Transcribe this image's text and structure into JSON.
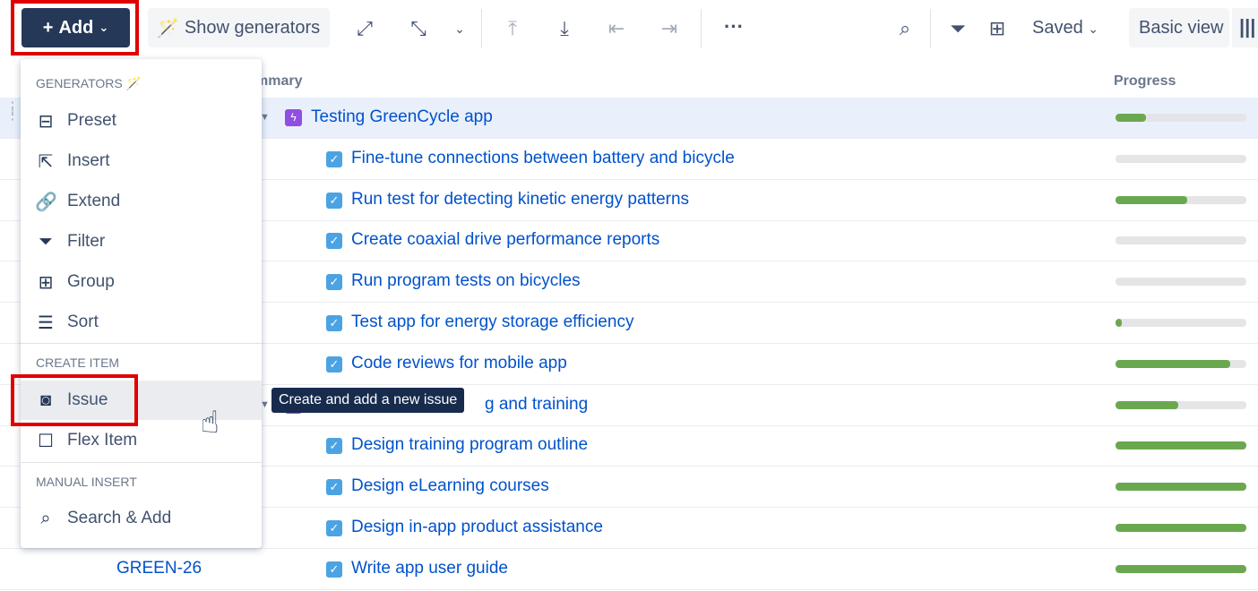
{
  "toolbar": {
    "add_label": "Add",
    "show_generators_label": "Show generators",
    "saved_label": "Saved",
    "basic_view_label": "Basic view",
    "more_label": "···"
  },
  "columns": {
    "summary": "mmary",
    "progress": "Progress"
  },
  "rows": [
    {
      "id": "",
      "title": "Testing GreenCycle app",
      "type": "epic",
      "progress": 23,
      "selected": true
    },
    {
      "id": "",
      "title": "Fine-tune connections between battery and bicycle",
      "type": "task",
      "progress": 0
    },
    {
      "id": "",
      "title": "Run test for detecting kinetic energy patterns",
      "type": "task",
      "progress": 55
    },
    {
      "id": "",
      "title": "Create coaxial drive performance reports",
      "type": "task",
      "progress": 0
    },
    {
      "id": "",
      "title": "Run program tests on bicycles",
      "type": "task",
      "progress": 0
    },
    {
      "id": "",
      "title": "Test app for energy storage efficiency",
      "type": "task",
      "progress": 5
    },
    {
      "id": "",
      "title": "Code reviews for mobile app",
      "type": "task",
      "progress": 88
    },
    {
      "id": "",
      "title": "g and training",
      "type": "epic",
      "progress": 48
    },
    {
      "id": "",
      "title": "Design training program outline",
      "type": "task",
      "progress": 100
    },
    {
      "id": "",
      "title": "Design eLearning courses",
      "type": "task",
      "progress": 100
    },
    {
      "id": "",
      "title": "Design in-app product assistance",
      "type": "task",
      "progress": 100
    },
    {
      "id": "GREEN-26",
      "title": "Write app user guide",
      "type": "task",
      "progress": 100
    }
  ],
  "menu": {
    "generators_header": "GENERATORS",
    "generators": [
      {
        "label": "Preset",
        "icon": "toolbox-icon"
      },
      {
        "label": "Insert",
        "icon": "insert-icon"
      },
      {
        "label": "Extend",
        "icon": "link-icon"
      },
      {
        "label": "Filter",
        "icon": "filter-icon"
      },
      {
        "label": "Group",
        "icon": "group-icon"
      },
      {
        "label": "Sort",
        "icon": "sort-icon"
      }
    ],
    "create_header": "CREATE ITEM",
    "create": [
      {
        "label": "Issue",
        "icon": "issue-icon"
      },
      {
        "label": "Flex Item",
        "icon": "flex-item-icon"
      }
    ],
    "manual_header": "MANUAL INSERT",
    "manual": [
      {
        "label": "Search & Add",
        "icon": "search-icon"
      }
    ]
  },
  "tooltip": "Create and add a new issue",
  "colors": {
    "add_button": "#253858",
    "link": "#0052cc",
    "progress_fill": "#6aa84f",
    "highlight": "#e00000"
  }
}
